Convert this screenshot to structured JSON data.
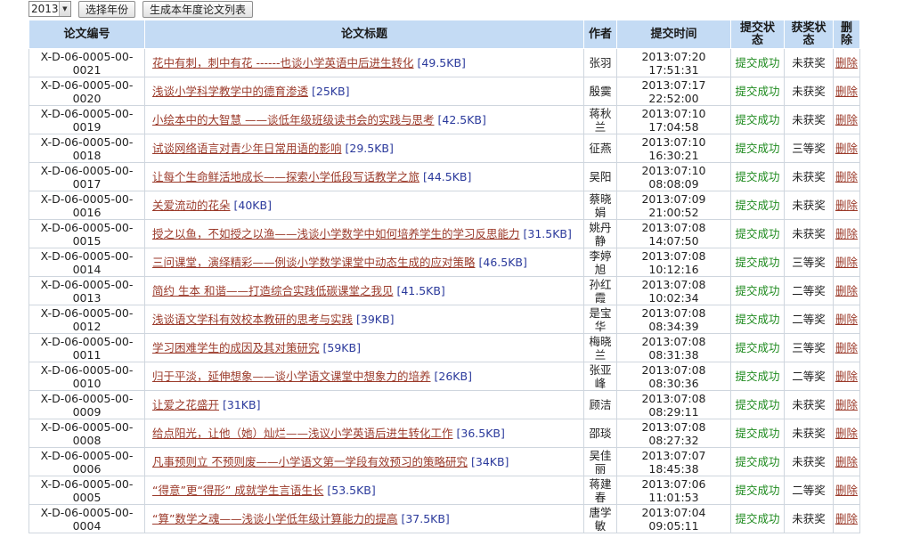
{
  "toolbar": {
    "year_value": "2013",
    "select_year_button": "选择年份",
    "generate_list_button": "生成本年度论文列表"
  },
  "headers": {
    "id": "论文编号",
    "title": "论文标题",
    "author": "作者",
    "time": "提交时间",
    "status_line1": "提交状",
    "status_line2": "态",
    "award_line1": "获奖状",
    "award_line2": "态",
    "delete_line1": "删",
    "delete_line2": "除"
  },
  "rows": [
    {
      "id1": "X-D-06-0005-00-",
      "id2": "0021",
      "title": "花中有刺，刺中有花 ------也谈小学英语中后进生转化",
      "size": "[49.5KB]",
      "author1": "张羽",
      "author2": "",
      "date": "2013:07:20",
      "clock": "17:51:31",
      "status": "提交成功",
      "award": "未获奖",
      "del": "删除"
    },
    {
      "id1": "X-D-06-0005-00-",
      "id2": "0020",
      "title": "浅谈小学科学教学中的德育渗透",
      "size": "[25KB]",
      "author1": "殷霙",
      "author2": "",
      "date": "2013:07:17",
      "clock": "22:52:00",
      "status": "提交成功",
      "award": "未获奖",
      "del": "删除"
    },
    {
      "id1": "X-D-06-0005-00-",
      "id2": "0019",
      "title": "小绘本中的大智慧 ——谈低年级班级读书会的实践与思考",
      "size": "[42.5KB]",
      "author1": "蒋秋",
      "author2": "兰",
      "date": "2013:07:10",
      "clock": "17:04:58",
      "status": "提交成功",
      "award": "未获奖",
      "del": "删除"
    },
    {
      "id1": "X-D-06-0005-00-",
      "id2": "0018",
      "title": "试谈网络语言对青少年日常用语的影响",
      "size": "[29.5KB]",
      "author1": "征燕",
      "author2": "",
      "date": "2013:07:10",
      "clock": "16:30:21",
      "status": "提交成功",
      "award": "三等奖",
      "del": "删除"
    },
    {
      "id1": "X-D-06-0005-00-",
      "id2": "0017",
      "title": "让每个生命鲜活地成长——探索小学低段写话教学之旅",
      "size": "[44.5KB]",
      "author1": "吴阳",
      "author2": "",
      "date": "2013:07:10",
      "clock": "08:08:09",
      "status": "提交成功",
      "award": "未获奖",
      "del": "删除"
    },
    {
      "id1": "X-D-06-0005-00-",
      "id2": "0016",
      "title": "关爱流动的花朵",
      "size": "[40KB]",
      "author1": "蔡晓",
      "author2": "娟",
      "date": "2013:07:09",
      "clock": "21:00:52",
      "status": "提交成功",
      "award": "未获奖",
      "del": "删除"
    },
    {
      "id1": "X-D-06-0005-00-",
      "id2": "0015",
      "title": "授之以鱼，不如授之以渔——浅谈小学数学中如何培养学生的学习反思能力",
      "size": "[31.5KB]",
      "author1": "姚丹",
      "author2": "静",
      "date": "2013:07:08",
      "clock": "14:07:50",
      "status": "提交成功",
      "award": "未获奖",
      "del": "删除"
    },
    {
      "id1": "X-D-06-0005-00-",
      "id2": "0014",
      "title": "三问课堂，演绎精彩——例谈小学数学课堂中动态生成的应对策略",
      "size": "[46.5KB]",
      "author1": "李婷",
      "author2": "旭",
      "date": "2013:07:08",
      "clock": "10:12:16",
      "status": "提交成功",
      "award": "三等奖",
      "del": "删除"
    },
    {
      "id1": "X-D-06-0005-00-",
      "id2": "0013",
      "title": "简约 生本 和谐——打造综合实践低碳课堂之我见",
      "size": "[41.5KB]",
      "author1": "孙红",
      "author2": "霞",
      "date": "2013:07:08",
      "clock": "10:02:34",
      "status": "提交成功",
      "award": "二等奖",
      "del": "删除"
    },
    {
      "id1": "X-D-06-0005-00-",
      "id2": "0012",
      "title": "浅谈语文学科有效校本教研的思考与实践",
      "size": "[39KB]",
      "author1": "是宝",
      "author2": "华",
      "date": "2013:07:08",
      "clock": "08:34:39",
      "status": "提交成功",
      "award": "二等奖",
      "del": "删除"
    },
    {
      "id1": "X-D-06-0005-00-",
      "id2": "0011",
      "title": "学习困难学生的成因及其对策研究",
      "size": "[59KB]",
      "author1": "梅晓",
      "author2": "兰",
      "date": "2013:07:08",
      "clock": "08:31:38",
      "status": "提交成功",
      "award": "三等奖",
      "del": "删除"
    },
    {
      "id1": "X-D-06-0005-00-",
      "id2": "0010",
      "title": "归于平淡，延伸想象——谈小学语文课堂中想象力的培养",
      "size": "[26KB]",
      "author1": "张亚",
      "author2": "峰",
      "date": "2013:07:08",
      "clock": "08:30:36",
      "status": "提交成功",
      "award": "二等奖",
      "del": "删除"
    },
    {
      "id1": "X-D-06-0005-00-",
      "id2": "0009",
      "title": "让爱之花盛开",
      "size": "[31KB]",
      "author1": "顾洁",
      "author2": "",
      "date": "2013:07:08",
      "clock": "08:29:11",
      "status": "提交成功",
      "award": "未获奖",
      "del": "删除"
    },
    {
      "id1": "X-D-06-0005-00-",
      "id2": "0008",
      "title": "给点阳光，让他（她）灿烂——浅议小学英语后进生转化工作",
      "size": "[36.5KB]",
      "author1": "邵琰",
      "author2": "",
      "date": "2013:07:08",
      "clock": "08:27:32",
      "status": "提交成功",
      "award": "未获奖",
      "del": "删除"
    },
    {
      "id1": "X-D-06-0005-00-",
      "id2": "0006",
      "title": "凡事预则立 不预则废——小学语文第一学段有效预习的策略研究",
      "size": "[34KB]",
      "author1": "吴佳",
      "author2": "丽",
      "date": "2013:07:07",
      "clock": "18:45:38",
      "status": "提交成功",
      "award": "未获奖",
      "del": "删除"
    },
    {
      "id1": "X-D-06-0005-00-",
      "id2": "0005",
      "title": "“得意”更“得形” 成就学生言语生长",
      "size": "[53.5KB]",
      "author1": "蒋建",
      "author2": "春",
      "date": "2013:07:06",
      "clock": "11:01:53",
      "status": "提交成功",
      "award": "二等奖",
      "del": "删除"
    },
    {
      "id1": "X-D-06-0005-00-",
      "id2": "0004",
      "title": "“算”数学之魂——浅谈小学低年级计算能力的提高",
      "size": "[37.5KB]",
      "author1": "唐学",
      "author2": "敏",
      "date": "2013:07:04",
      "clock": "09:05:11",
      "status": "提交成功",
      "award": "未获奖",
      "del": "删除"
    }
  ],
  "colors": {
    "header_bg": "#c4dbf4",
    "title_link": "#9b3a2a",
    "size_text": "#2b3a9c",
    "status_ok": "#1e8a1e"
  }
}
